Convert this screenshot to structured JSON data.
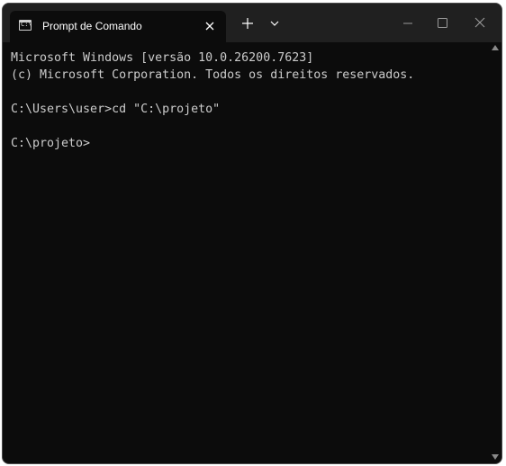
{
  "window": {
    "tab_title": "Prompt de Comando",
    "tab_icon": "cmd-icon",
    "new_tab_icon": "plus-icon",
    "dropdown_icon": "chevron-down-icon",
    "minimize_icon": "minimize-icon",
    "maximize_icon": "maximize-icon",
    "close_icon": "close-icon"
  },
  "console": {
    "lines": [
      "Microsoft Windows [versão 10.0.26200.7623]",
      "(c) Microsoft Corporation. Todos os direitos reservados.",
      "",
      "C:\\Users\\user>cd \"C:\\projeto\"",
      "",
      "C:\\projeto>"
    ]
  },
  "colors": {
    "background": "#0c0c0c",
    "titlebar": "#202020",
    "text": "#cccccc"
  }
}
